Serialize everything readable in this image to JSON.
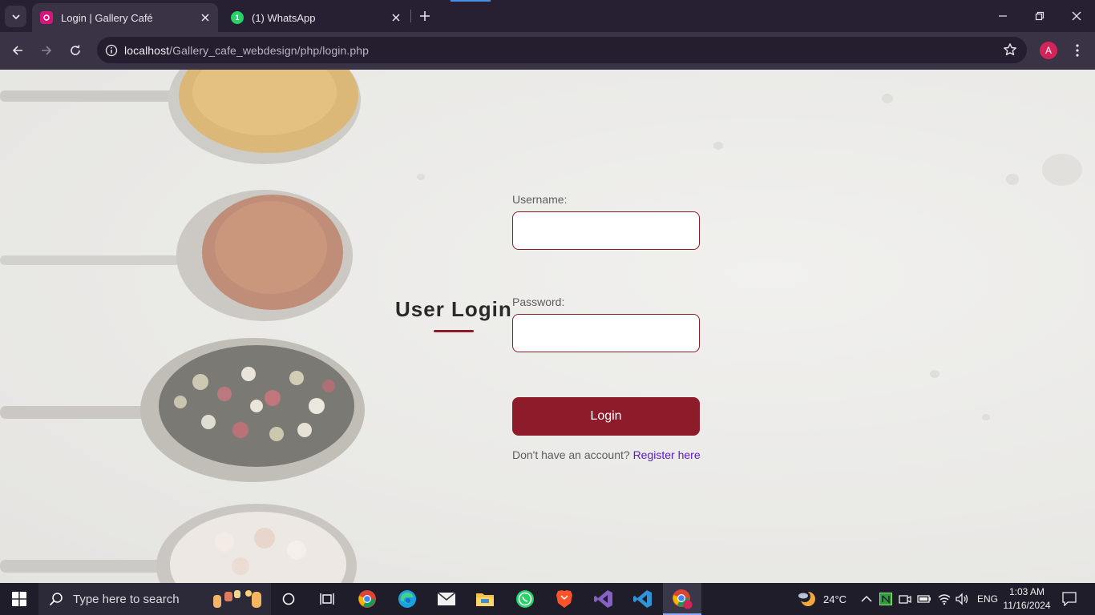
{
  "browser": {
    "tabs": [
      {
        "title": "Login | Gallery Café",
        "favicon": "gallery-cafe-icon",
        "active": true
      },
      {
        "title": "(1) WhatsApp",
        "favicon": "whatsapp-icon",
        "active": false
      }
    ],
    "url_host": "localhost",
    "url_path": "/Gallery_cafe_webdesign/php/login.php",
    "profile_initial": "A"
  },
  "login": {
    "heading": "User Login",
    "username_label": "Username:",
    "username_value": "",
    "password_label": "Password:",
    "password_value": "",
    "submit_label": "Login",
    "register_prompt": "Don't have an account?",
    "register_link": "Register here"
  },
  "taskbar": {
    "search_placeholder": "Type here to search",
    "weather_temp": "24°C",
    "language": "ENG",
    "time": "1:03 AM",
    "date": "11/16/2024",
    "pinned_apps": [
      "cortana-icon",
      "task-view-icon",
      "chrome-icon",
      "edge-icon",
      "mail-icon",
      "file-explorer-icon",
      "whatsapp-icon",
      "brave-icon",
      "visual-studio-icon",
      "vscode-icon",
      "chrome-profile-icon"
    ]
  },
  "colors": {
    "accent": "#8e1b2a",
    "link": "#5a17c9",
    "tab_bar": "#262032",
    "toolbar": "#3a3346"
  }
}
